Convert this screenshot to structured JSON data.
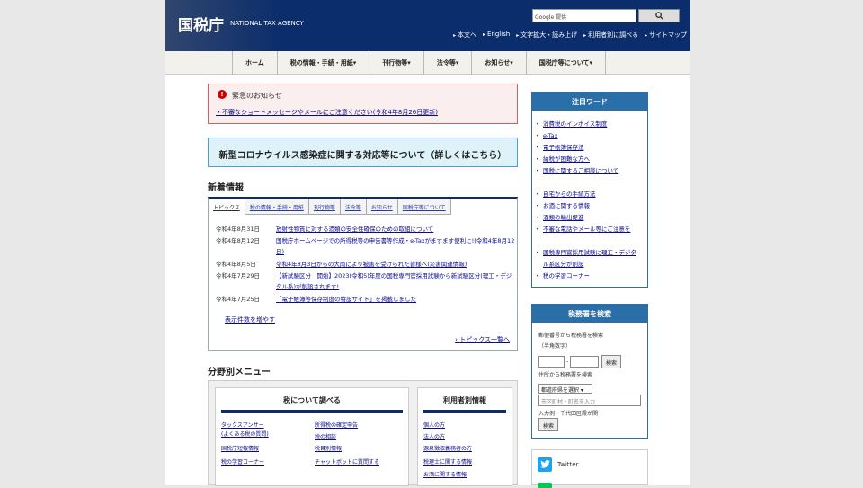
{
  "header": {
    "logo": "国税庁",
    "logo_en": "NATIONAL TAX AGENCY",
    "search_placeholder": "Google 提供",
    "search_button_icon": "search-icon",
    "utility_links": [
      "本文へ",
      "English",
      "文字拡大・読み上げ",
      "利用者別に調べる",
      "サイトマップ"
    ]
  },
  "nav": {
    "items": [
      "ホーム",
      "税の情報・手続・用紙▾",
      "刊行物等▾",
      "法令等▾",
      "お知らせ▾",
      "国税庁等について▾"
    ]
  },
  "alert": {
    "icon": "!",
    "title": "緊急のお知らせ",
    "link": "・不審なショートメッセージやメールにご注意ください(令和4年8月26日更新)"
  },
  "corona": {
    "text": "新型コロナウイルス感染症に関する対応等について（詳しくはこちら）"
  },
  "news": {
    "title": "新着情報",
    "tabs": [
      "トピックス",
      "税の情報・手続・用紙",
      "刊行物等",
      "法令等",
      "お知らせ",
      "国税庁等について"
    ],
    "items": [
      {
        "date": "令和4年8月31日",
        "text": "放射性物質に対する酒類の安全性確保のための取組について"
      },
      {
        "date": "令和4年8月12日",
        "text": "国税庁ホームページでの所得税等の申告書等作成・e-Taxがますます便利に!(令和4年8月12日)"
      },
      {
        "date": "令和4年8月5日",
        "text": "令和4年8月3日からの大雨により被害を受けられた皆様へ(災害関連情報)"
      },
      {
        "date": "令和4年7月29日",
        "text": "【新試験区分　開始】2023(令和5)年度の国税専門官採用試験から新試験区分(理工・デジタル系)が創設されます!"
      },
      {
        "date": "令和4年7月25日",
        "text": "「電子帳簿等保存制度の特設サイト」を掲載しました"
      }
    ],
    "more": "表示件数を増やす",
    "all": "トピックス一覧へ"
  },
  "bunya": {
    "title": "分野別メニュー",
    "box1": {
      "title": "税について調べる",
      "col1": [
        "タックスアンサー",
        "(よくある税の質問)",
        "国税庁短報情報",
        "税の学習コーナー"
      ],
      "col2": [
        "所得税の確定申告",
        "税の相談",
        "税目別情報",
        "チャットボットに質問する"
      ]
    },
    "box2": {
      "title": "利用者別情報",
      "links": [
        "個人の方",
        "法人の方",
        "源泉徴収義務者の方",
        "税理士に関する情報",
        "お酒に関する情報"
      ]
    }
  },
  "keywords": {
    "title": "注目ワード",
    "items": [
      "消費税のインボイス制度",
      "e-Tax",
      "電子帳簿保存法",
      "納税が困難な方へ",
      "国税に関するご相談について",
      "自宅からの手続方法",
      "お酒に関する情報",
      "酒類の輸出促進",
      "不審な電話やメール等にご注意を",
      "国税専門官採用試験に理工・デジタル系区分が創設",
      "税の学習コーナー"
    ]
  },
  "office_search": {
    "title": "税務署を検索",
    "zip_label1": "郵便番号から税務署を検索",
    "zip_label2": "（半角数字）",
    "dash": "-",
    "search1": "検索",
    "addr_label": "住所から税務署を検索",
    "pref_select": "都道府県を選択",
    "city_placeholder": "市区町村・町名を入力",
    "example": "入力例：千代田区霞が関",
    "search2": "検索"
  },
  "social": {
    "twitter": "Twitter"
  }
}
